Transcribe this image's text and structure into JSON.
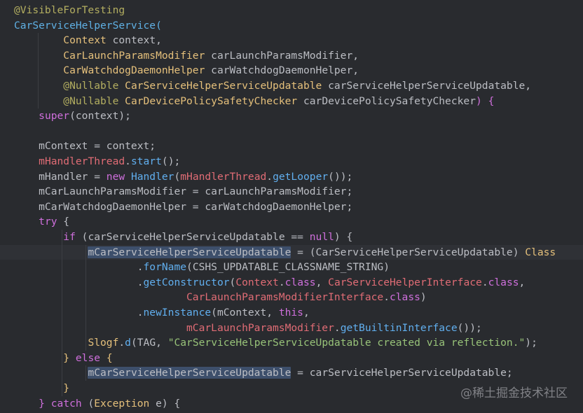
{
  "code_lines": [
    {
      "hl": false,
      "tokens": [
        {
          "t": "@VisibleForTesting",
          "c": "ann"
        }
      ]
    },
    {
      "hl": false,
      "tokens": [
        {
          "t": "CarServiceHelperService(",
          "c": "type"
        }
      ]
    },
    {
      "hl": false,
      "tokens": [
        {
          "t": "        ",
          "c": "plain"
        },
        {
          "t": "Context",
          "c": "class"
        },
        {
          "t": " context,",
          "c": "plain"
        }
      ]
    },
    {
      "hl": false,
      "tokens": [
        {
          "t": "        ",
          "c": "plain"
        },
        {
          "t": "CarLaunchParamsModifier",
          "c": "class"
        },
        {
          "t": " carLaunchParamsModifier,",
          "c": "plain"
        }
      ]
    },
    {
      "hl": false,
      "tokens": [
        {
          "t": "        ",
          "c": "plain"
        },
        {
          "t": "CarWatchdogDaemonHelper",
          "c": "class"
        },
        {
          "t": " carWatchdogDaemonHelper,",
          "c": "plain"
        }
      ]
    },
    {
      "hl": false,
      "tokens": [
        {
          "t": "        ",
          "c": "plain"
        },
        {
          "t": "@Nullable",
          "c": "ann"
        },
        {
          "t": " ",
          "c": "plain"
        },
        {
          "t": "CarServiceHelperServiceUpdatable",
          "c": "class"
        },
        {
          "t": " carServiceHelperServiceUpdatable,",
          "c": "plain"
        }
      ]
    },
    {
      "hl": false,
      "tokens": [
        {
          "t": "        ",
          "c": "plain"
        },
        {
          "t": "@Nullable",
          "c": "ann"
        },
        {
          "t": " ",
          "c": "plain"
        },
        {
          "t": "CarDevicePolicySafetyChecker",
          "c": "class"
        },
        {
          "t": " carDevicePolicySafetyChecker",
          "c": "plain"
        },
        {
          "t": ") {",
          "c": "kw"
        }
      ]
    },
    {
      "hl": false,
      "tokens": [
        {
          "t": "    ",
          "c": "plain"
        },
        {
          "t": "super",
          "c": "kw"
        },
        {
          "t": "(context);",
          "c": "plain"
        }
      ]
    },
    {
      "hl": false,
      "tokens": [
        {
          "t": "",
          "c": "plain"
        }
      ]
    },
    {
      "hl": false,
      "tokens": [
        {
          "t": "    mContext = context;",
          "c": "plain"
        }
      ]
    },
    {
      "hl": false,
      "tokens": [
        {
          "t": "    ",
          "c": "plain"
        },
        {
          "t": "mHandlerThread",
          "c": "field"
        },
        {
          "t": ".",
          "c": "plain"
        },
        {
          "t": "start",
          "c": "fn"
        },
        {
          "t": "();",
          "c": "plain"
        }
      ]
    },
    {
      "hl": false,
      "tokens": [
        {
          "t": "    mHandler = ",
          "c": "plain"
        },
        {
          "t": "new",
          "c": "kw"
        },
        {
          "t": " ",
          "c": "plain"
        },
        {
          "t": "Handler",
          "c": "fn"
        },
        {
          "t": "(",
          "c": "plain"
        },
        {
          "t": "mHandlerThread",
          "c": "field"
        },
        {
          "t": ".",
          "c": "plain"
        },
        {
          "t": "getLooper",
          "c": "fn"
        },
        {
          "t": "());",
          "c": "plain"
        }
      ]
    },
    {
      "hl": false,
      "tokens": [
        {
          "t": "    mCarLaunchParamsModifier = carLaunchParamsModifier;",
          "c": "plain"
        }
      ]
    },
    {
      "hl": false,
      "tokens": [
        {
          "t": "    mCarWatchdogDaemonHelper = carWatchdogDaemonHelper;",
          "c": "plain"
        }
      ]
    },
    {
      "hl": false,
      "tokens": [
        {
          "t": "    ",
          "c": "plain"
        },
        {
          "t": "try",
          "c": "kw"
        },
        {
          "t": " {",
          "c": "plain"
        }
      ]
    },
    {
      "hl": false,
      "tokens": [
        {
          "t": "        ",
          "c": "plain"
        },
        {
          "t": "if",
          "c": "kw"
        },
        {
          "t": " (carServiceHelperServiceUpdatable == ",
          "c": "plain"
        },
        {
          "t": "null",
          "c": "kw"
        },
        {
          "t": ") {",
          "c": "plain"
        }
      ]
    },
    {
      "hl": true,
      "tokens": [
        {
          "t": "            ",
          "c": "plain"
        },
        {
          "t": "mCarServiceHelperServiceUpdatable",
          "c": "sel"
        },
        {
          "t": " = (CarServiceHelperServiceUpdatable) ",
          "c": "plain"
        },
        {
          "t": "Class",
          "c": "class"
        }
      ]
    },
    {
      "hl": false,
      "tokens": [
        {
          "t": "                    .",
          "c": "plain"
        },
        {
          "t": "forName",
          "c": "fn"
        },
        {
          "t": "(CSHS_UPDATABLE_CLASSNAME_STRING)",
          "c": "plain"
        }
      ]
    },
    {
      "hl": false,
      "tokens": [
        {
          "t": "                    .",
          "c": "plain"
        },
        {
          "t": "getConstructor",
          "c": "fn"
        },
        {
          "t": "(",
          "c": "plain"
        },
        {
          "t": "Context",
          "c": "field"
        },
        {
          "t": ".",
          "c": "plain"
        },
        {
          "t": "class",
          "c": "kw"
        },
        {
          "t": ", ",
          "c": "plain"
        },
        {
          "t": "CarServiceHelperInterface",
          "c": "field"
        },
        {
          "t": ".",
          "c": "plain"
        },
        {
          "t": "class",
          "c": "kw"
        },
        {
          "t": ",",
          "c": "plain"
        }
      ]
    },
    {
      "hl": false,
      "tokens": [
        {
          "t": "                            ",
          "c": "plain"
        },
        {
          "t": "CarLaunchParamsModifierInterface",
          "c": "field"
        },
        {
          "t": ".",
          "c": "plain"
        },
        {
          "t": "class",
          "c": "kw"
        },
        {
          "t": ")",
          "c": "plain"
        }
      ]
    },
    {
      "hl": false,
      "tokens": [
        {
          "t": "                    .",
          "c": "plain"
        },
        {
          "t": "newInstance",
          "c": "fn"
        },
        {
          "t": "(mContext, ",
          "c": "plain"
        },
        {
          "t": "this",
          "c": "kw"
        },
        {
          "t": ",",
          "c": "plain"
        }
      ]
    },
    {
      "hl": false,
      "tokens": [
        {
          "t": "                            ",
          "c": "plain"
        },
        {
          "t": "mCarLaunchParamsModifier",
          "c": "field"
        },
        {
          "t": ".",
          "c": "plain"
        },
        {
          "t": "getBuiltinInterface",
          "c": "fn"
        },
        {
          "t": "());",
          "c": "plain"
        }
      ]
    },
    {
      "hl": false,
      "tokens": [
        {
          "t": "            ",
          "c": "plain"
        },
        {
          "t": "Slogf",
          "c": "class"
        },
        {
          "t": ".",
          "c": "plain"
        },
        {
          "t": "d",
          "c": "fn"
        },
        {
          "t": "(TAG, ",
          "c": "plain"
        },
        {
          "t": "\"CarServiceHelperServiceUpdatable created via reflection.\"",
          "c": "str"
        },
        {
          "t": ");",
          "c": "plain"
        }
      ]
    },
    {
      "hl": false,
      "tokens": [
        {
          "t": "        ",
          "c": "plain"
        },
        {
          "t": "}",
          "c": "class"
        },
        {
          "t": " ",
          "c": "plain"
        },
        {
          "t": "else",
          "c": "kw"
        },
        {
          "t": " ",
          "c": "plain"
        },
        {
          "t": "{",
          "c": "class"
        }
      ]
    },
    {
      "hl": false,
      "tokens": [
        {
          "t": "            ",
          "c": "plain"
        },
        {
          "t": "mCarServiceHelperServiceUpdatable",
          "c": "sel"
        },
        {
          "t": " = carServiceHelperServiceUpdatable;",
          "c": "plain"
        }
      ]
    },
    {
      "hl": false,
      "tokens": [
        {
          "t": "        ",
          "c": "plain"
        },
        {
          "t": "}",
          "c": "class"
        }
      ]
    },
    {
      "hl": false,
      "tokens": [
        {
          "t": "    ",
          "c": "plain"
        },
        {
          "t": "}",
          "c": "kw"
        },
        {
          "t": " ",
          "c": "plain"
        },
        {
          "t": "catch",
          "c": "kw"
        },
        {
          "t": " (",
          "c": "plain"
        },
        {
          "t": "Exception",
          "c": "class"
        },
        {
          "t": " e) {",
          "c": "plain"
        }
      ]
    }
  ],
  "watermark": "@稀土掘金技术社区"
}
